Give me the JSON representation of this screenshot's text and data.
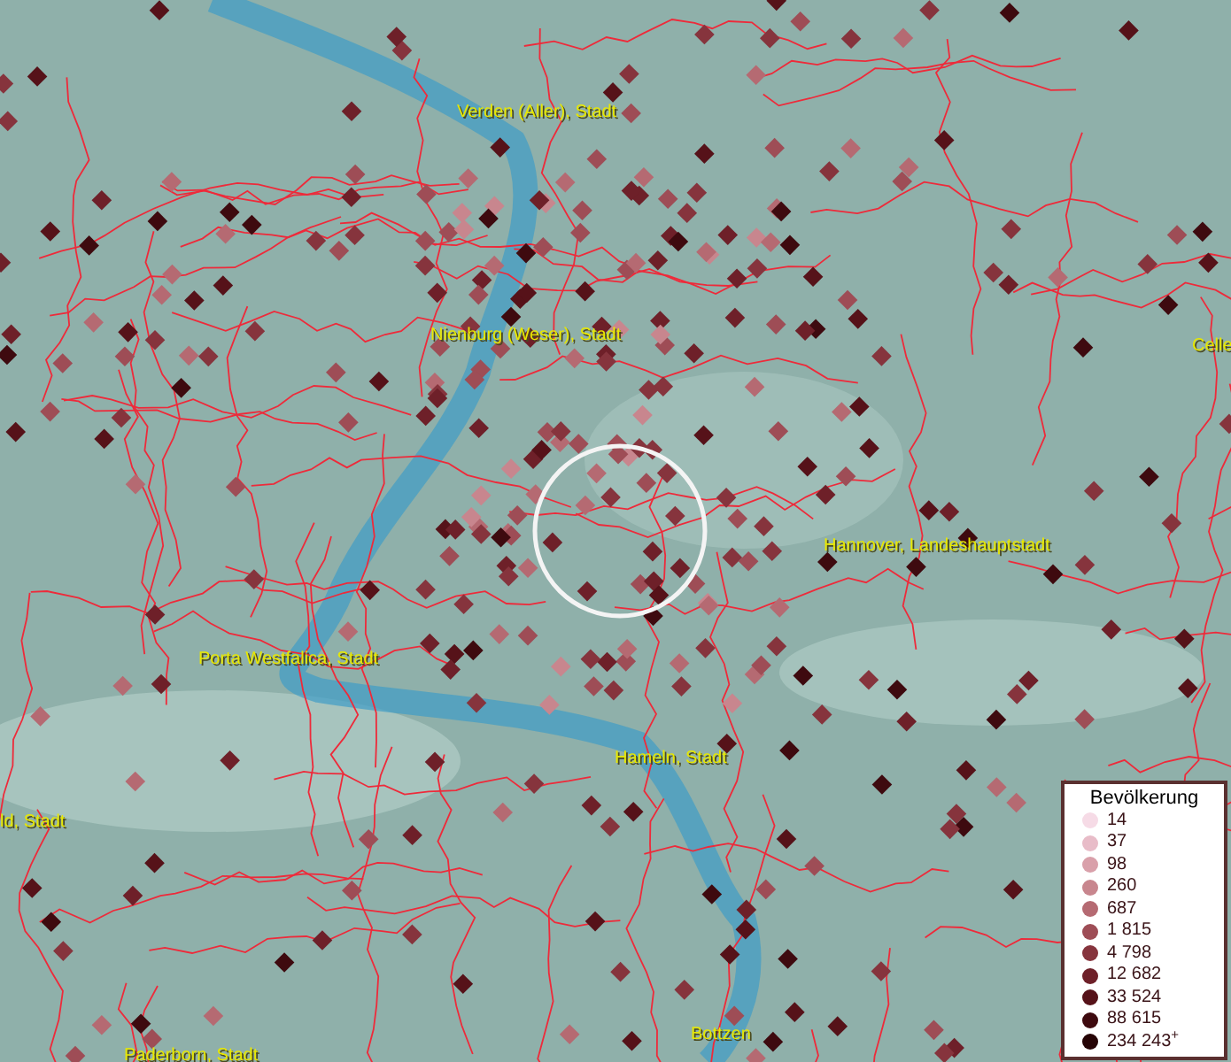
{
  "map_labels": [
    {
      "text": "Verden (Aller), Stadt"
    },
    {
      "text": "Nienburg (Weser), Stadt"
    },
    {
      "text": "Celle"
    },
    {
      "text": "Hannover, Landeshauptstadt"
    },
    {
      "text": "Porta Westfalica, Stadt"
    },
    {
      "text": "Hameln, Stadt"
    },
    {
      "text": "ld, Stadt"
    },
    {
      "text": "Bottzen"
    },
    {
      "text": "Paderborn, Stadt"
    }
  ],
  "legend": {
    "title": "Bevölkerung",
    "items": [
      {
        "label": "14",
        "color": "#f6dbe6"
      },
      {
        "label": "37",
        "color": "#e8bcc8"
      },
      {
        "label": "98",
        "color": "#d9a0aa"
      },
      {
        "label": "260",
        "color": "#c8868e"
      },
      {
        "label": "687",
        "color": "#b56a72"
      },
      {
        "label": "1 815",
        "color": "#9e4d56"
      },
      {
        "label": "4 798",
        "color": "#86343d"
      },
      {
        "label": "12 682",
        "color": "#6e2029"
      },
      {
        "label": "33 524",
        "color": "#561219"
      },
      {
        "label": "88 615",
        "color": "#3e0a0f"
      },
      {
        "label": "234 243$^{+}$",
        "color": "#260406"
      }
    ]
  }
}
